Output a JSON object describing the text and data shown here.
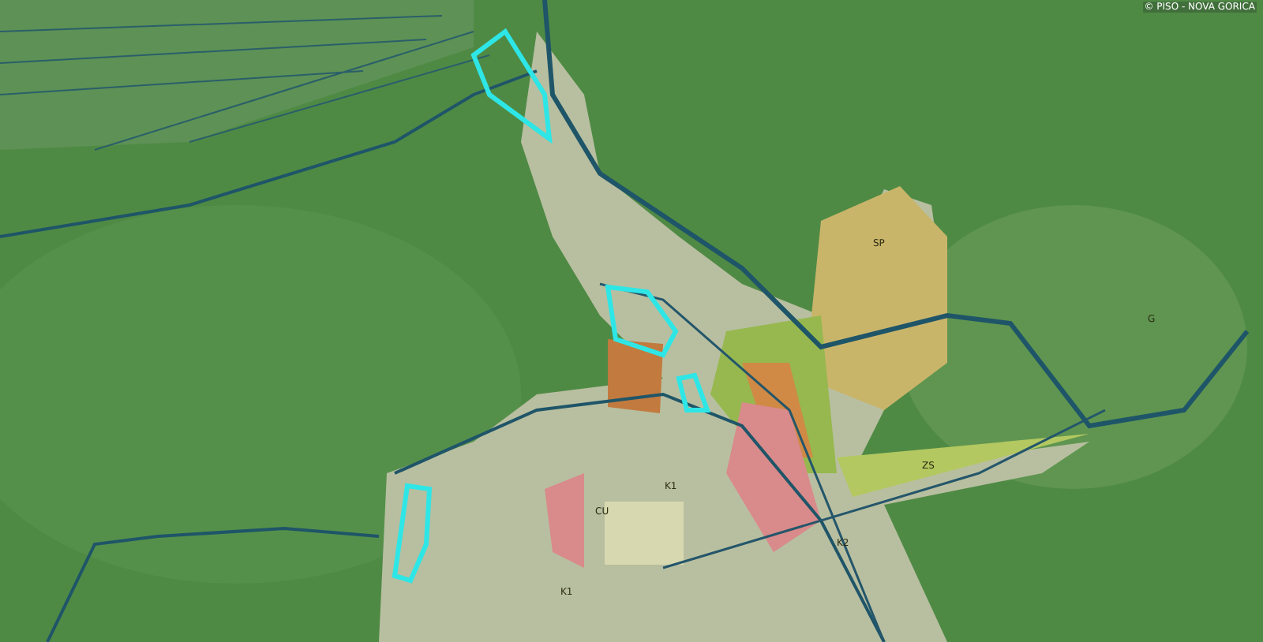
{
  "map": {
    "credit": "© PISO - NOVA GORICA",
    "zone_labels": [
      {
        "text": "SP"
      },
      {
        "text": "G"
      },
      {
        "text": "K1"
      },
      {
        "text": "CU"
      },
      {
        "text": "ZS"
      },
      {
        "text": "K2"
      },
      {
        "text": "K1"
      }
    ]
  }
}
